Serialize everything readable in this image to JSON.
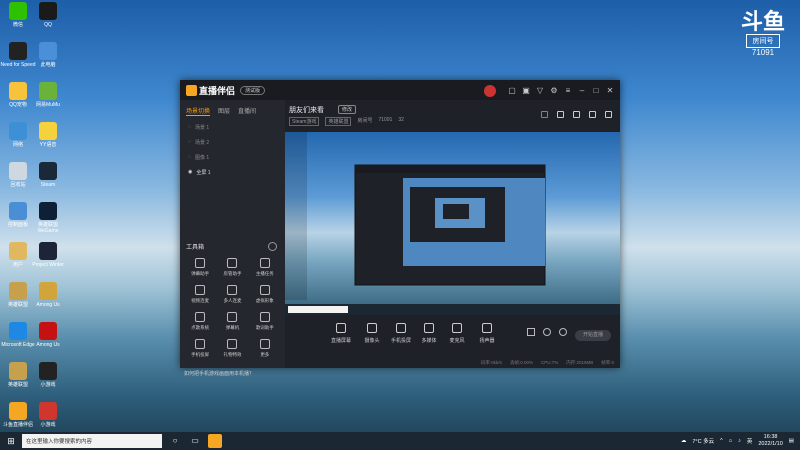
{
  "watermark": {
    "brand": "斗鱼",
    "room_label": "房间号",
    "room_no": "71091"
  },
  "desktop_icons": [
    {
      "name": "wechat",
      "label": "微信",
      "color": "#2dc100"
    },
    {
      "name": "qq",
      "label": "QQ",
      "color": "#1a1a1a"
    },
    {
      "name": "needforspeed",
      "label": "Need for Speed",
      "color": "#222"
    },
    {
      "name": "computer",
      "label": "此电脑",
      "color": "#4a90d9"
    },
    {
      "name": "qqpet",
      "label": "QQ宠物",
      "color": "#f6c33b"
    },
    {
      "name": "app",
      "label": "网易MuMu",
      "color": "#6bb23a"
    },
    {
      "name": "network",
      "label": "网络",
      "color": "#3d8fd6"
    },
    {
      "name": "yy",
      "label": "YY语音",
      "color": "#f5d23b"
    },
    {
      "name": "recycle",
      "label": "回收站",
      "color": "#cfd8e0"
    },
    {
      "name": "steam",
      "label": "Steam",
      "color": "#1b2838"
    },
    {
      "name": "panel",
      "label": "控制面板",
      "color": "#4a8fd6"
    },
    {
      "name": "game1",
      "label": "英雄联盟WeGame",
      "color": "#0d2036"
    },
    {
      "name": "user",
      "label": "用户",
      "color": "#e0b860"
    },
    {
      "name": "project",
      "label": "Project Winter",
      "color": "#1d2438"
    },
    {
      "name": "lol",
      "label": "英雄联盟",
      "color": "#c7a04d"
    },
    {
      "name": "key",
      "label": "Among Us",
      "color": "#d2a43c"
    },
    {
      "name": "edge",
      "label": "Microsoft Edge",
      "color": "#1e88e5"
    },
    {
      "name": "among",
      "label": "Among Us",
      "color": "#c51111"
    },
    {
      "name": "lol2",
      "label": "英雄联盟",
      "color": "#c7a04d"
    },
    {
      "name": "mini",
      "label": "小游戏",
      "color": "#222"
    },
    {
      "name": "live",
      "label": "斗鱼直播伴侣",
      "color": "#f5a623"
    },
    {
      "name": "red",
      "label": "小游戏",
      "color": "#d0362d"
    }
  ],
  "app": {
    "title": "直播伴侣",
    "version_badge": "测试版",
    "left_tabs": [
      "场景切换",
      "图层",
      "直播间"
    ],
    "scenes": [
      "场景 1",
      "场景 2",
      "图像 1"
    ],
    "selected_scene": "全屏 1",
    "tools_heading": "工具箱",
    "tools": [
      "弹幕助手",
      "房管助手",
      "主播任务",
      "视频连麦",
      "多人连麦",
      "虚拟形象",
      "点歌系统",
      "弹幕机",
      "歌词助手",
      "手机投屏",
      "礼物特效",
      "更多"
    ],
    "notice": "如何把手机游戏画面用本机播？",
    "room_title": "朋友们来看",
    "room_tag": "修改",
    "room_meta": [
      "Steam游戏",
      "英雄联盟",
      "房间号",
      "71091",
      "32"
    ],
    "controls": [
      "直播屏幕",
      "摄像头",
      "手机投屏",
      "多媒体",
      "麦克风",
      "扬声器"
    ],
    "golive": "开始直播",
    "status": [
      "码率:0kb/s",
      "丢帧:0.00%",
      "CPU:7%",
      "内存:2019MB",
      "帧率:0"
    ]
  },
  "taskbar": {
    "search_placeholder": "在这里输入你要搜索的内容",
    "weather": "7°C 多云",
    "time": "16:38",
    "date": "2022/1/10"
  }
}
